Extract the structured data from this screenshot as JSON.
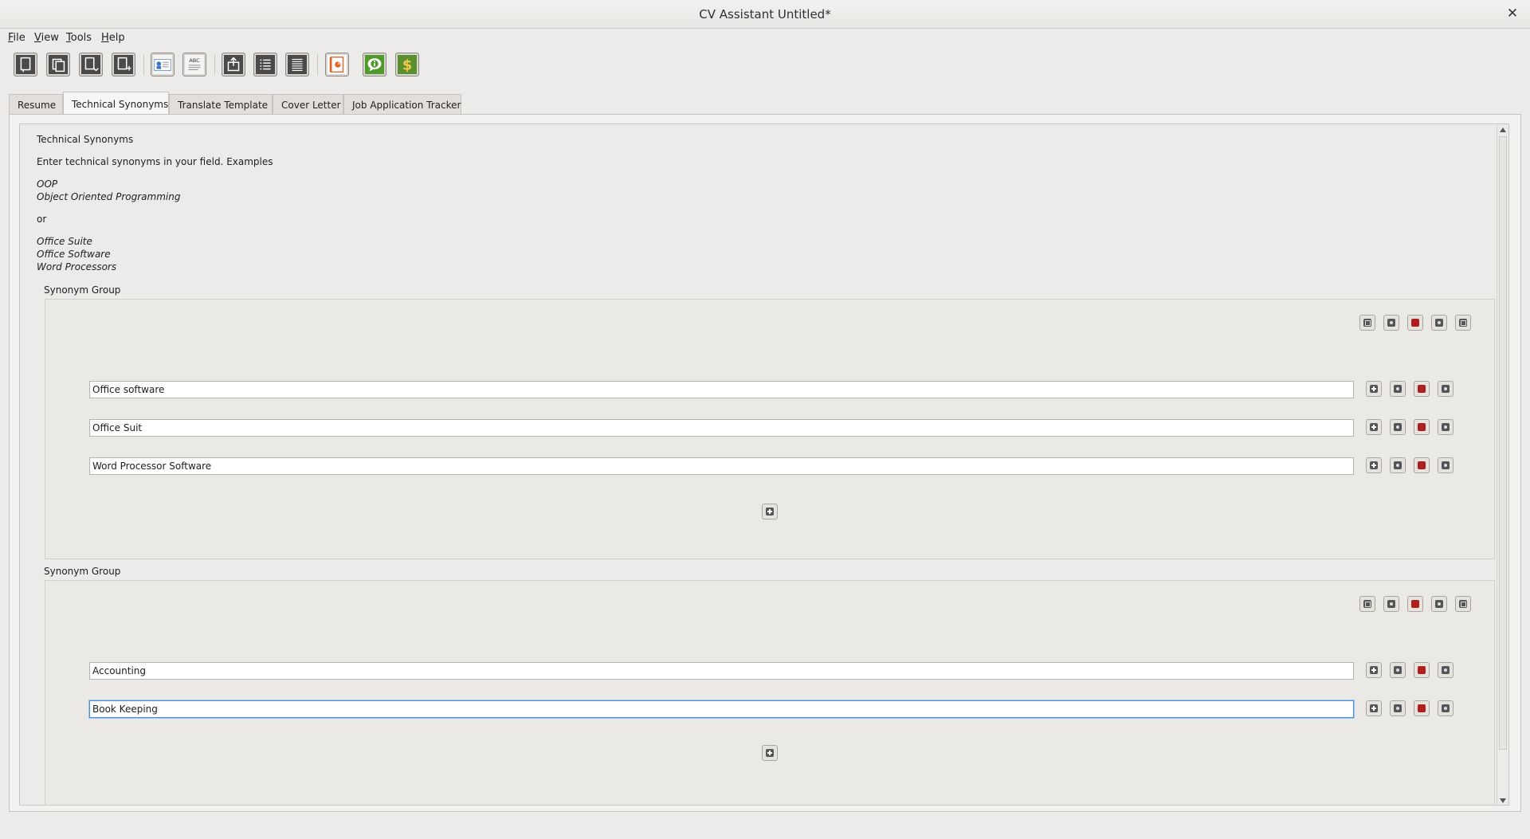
{
  "window": {
    "title": "CV Assistant Untitled*",
    "close_glyph": "✕"
  },
  "menu": [
    "File",
    "View",
    "Tools",
    "Help"
  ],
  "toolbar": {
    "buttons": [
      {
        "name": "new-document-icon"
      },
      {
        "name": "copy-document-icon"
      },
      {
        "name": "save-document-icon"
      },
      {
        "name": "save-as-document-icon"
      },
      {
        "name": "contact-card-icon"
      },
      {
        "name": "spell-check-icon",
        "label": "ABC"
      },
      {
        "name": "export-icon"
      },
      {
        "name": "list-icon"
      },
      {
        "name": "detailed-list-icon"
      },
      {
        "name": "presentation-icon"
      },
      {
        "name": "info-icon"
      },
      {
        "name": "dollar-icon"
      }
    ]
  },
  "tabs": [
    {
      "label": "Resume",
      "active": false
    },
    {
      "label": "Technical Synonyms",
      "active": true
    },
    {
      "label": "Translate Template",
      "active": false
    },
    {
      "label": "Cover Letter",
      "active": false
    },
    {
      "label": "Job Application Tracker",
      "active": false
    }
  ],
  "intro": {
    "heading": "Technical Synonyms",
    "instructions": "Enter technical synonyms in your field. Examples",
    "example1": [
      "OOP",
      "Object Oriented Programming"
    ],
    "separator": "or",
    "example2": [
      "Office Suite",
      "Office Software",
      "Word Processors"
    ]
  },
  "groups": [
    {
      "label": "Synonym Group",
      "items": [
        "Office software",
        "Office Suit",
        "Word Processor Software"
      ]
    },
    {
      "label": "Synonym Group",
      "items": [
        "Accounting",
        "Book Keeping"
      ]
    }
  ],
  "colors": {
    "focus": "#4a90d9",
    "delete": "#b01e1e",
    "toolbar_green": "#4f9a2a",
    "toolbar_orange": "#e0662a"
  }
}
